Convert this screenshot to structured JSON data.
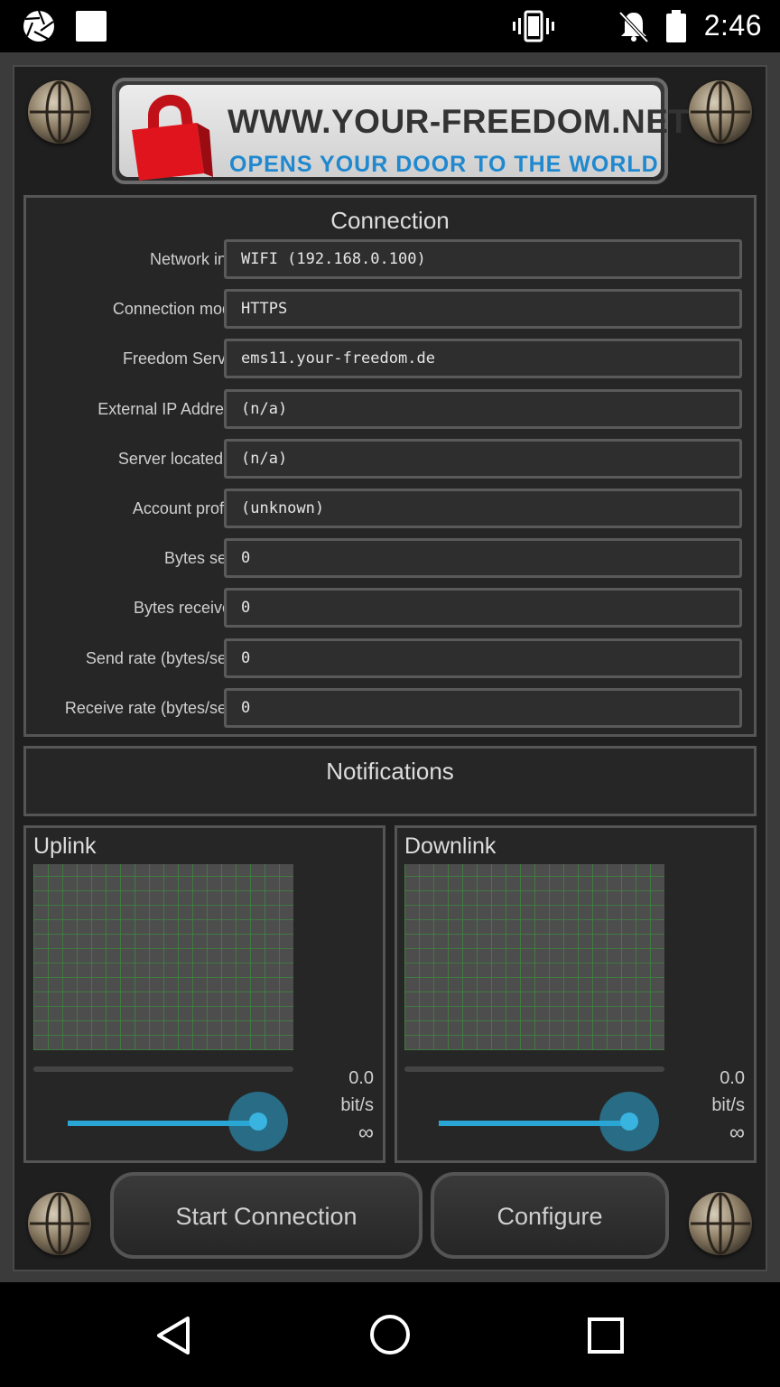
{
  "status_bar": {
    "time": "2:46",
    "icons": [
      "aperture-icon",
      "image-icon",
      "vibrate-icon",
      "no-notifications-icon",
      "battery-icon"
    ]
  },
  "banner": {
    "title": "WWW.YOUR-FREEDOM.NET",
    "subtitle": "OPENS YOUR DOOR TO THE WORLD",
    "subtitle_color": "#1f88cf",
    "lock_color": "#e0141c"
  },
  "connection": {
    "title": "Connection",
    "rows": [
      {
        "label": "Network info",
        "value": "WIFI (192.168.0.100)"
      },
      {
        "label": "Connection mode",
        "value": "HTTPS"
      },
      {
        "label": "Freedom Server",
        "value": "ems11.your-freedom.de"
      },
      {
        "label": "External IP Address",
        "value": "(n/a)"
      },
      {
        "label": "Server located in",
        "value": "(n/a)"
      },
      {
        "label": "Account profile",
        "value": "(unknown)"
      },
      {
        "label": "Bytes sent",
        "value": "0"
      },
      {
        "label": "Bytes received",
        "value": "0"
      },
      {
        "label": "Send rate (bytes/sec)",
        "value": "0"
      },
      {
        "label": "Receive rate (bytes/sec)",
        "value": "0"
      }
    ]
  },
  "notifications": {
    "title": "Notifications"
  },
  "uplink": {
    "title": "Uplink",
    "rate": "0.0",
    "unit": "bit/s",
    "limit": "∞"
  },
  "downlink": {
    "title": "Downlink",
    "rate": "0.0",
    "unit": "bit/s",
    "limit": "∞"
  },
  "slider_accent": "#2aa6d4",
  "buttons": {
    "start": "Start Connection",
    "configure": "Configure"
  }
}
